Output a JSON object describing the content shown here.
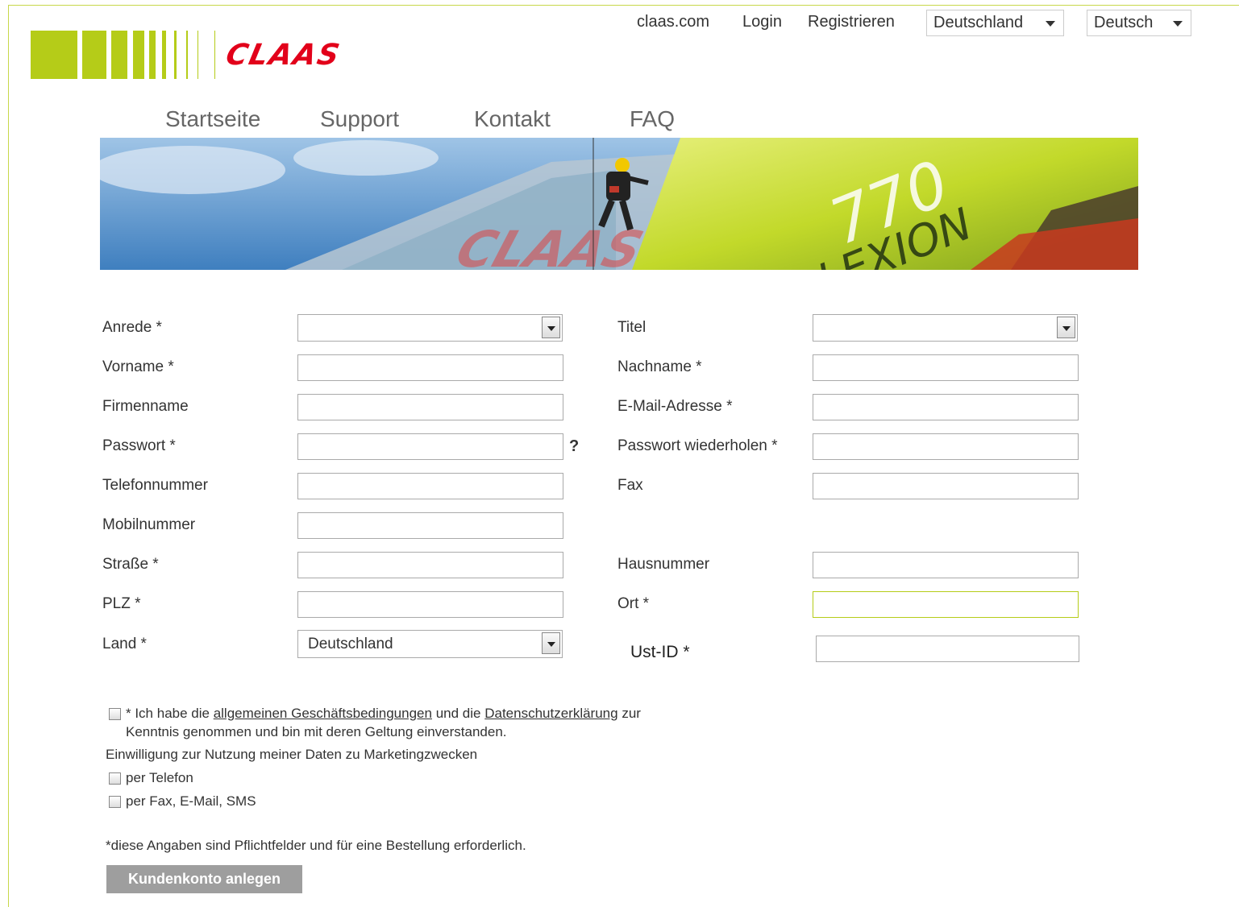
{
  "header": {
    "brand": "CLAAS",
    "links": {
      "claas": "claas.com",
      "login": "Login",
      "register": "Registrieren"
    },
    "country_select": "Deutschland",
    "language_select": "Deutsch"
  },
  "nav": {
    "home": "Startseite",
    "support": "Support",
    "contact": "Kontakt",
    "faq": "FAQ"
  },
  "banner": {
    "big_number": "770",
    "model": "LEXION",
    "brand": "CLAAS"
  },
  "form": {
    "anrede": {
      "label": "Anrede *",
      "value": ""
    },
    "titel": {
      "label": "Titel",
      "value": ""
    },
    "vorname": {
      "label": "Vorname *",
      "value": ""
    },
    "nachname": {
      "label": "Nachname *",
      "value": ""
    },
    "firmenname": {
      "label": "Firmenname",
      "value": ""
    },
    "email": {
      "label": "E-Mail-Adresse *",
      "value": ""
    },
    "passwort": {
      "label": "Passwort *",
      "value": ""
    },
    "passwort_help": "?",
    "passwort2": {
      "label": "Passwort wiederholen *",
      "value": ""
    },
    "telefon": {
      "label": "Telefonnummer",
      "value": ""
    },
    "fax": {
      "label": "Fax",
      "value": ""
    },
    "mobil": {
      "label": "Mobilnummer",
      "value": ""
    },
    "strasse": {
      "label": "Straße *",
      "value": ""
    },
    "hausnummer": {
      "label": "Hausnummer",
      "value": ""
    },
    "plz": {
      "label": "PLZ *",
      "value": ""
    },
    "ort": {
      "label": "Ort *",
      "value": ""
    },
    "land": {
      "label": "Land *",
      "value": "Deutschland"
    },
    "ustid": {
      "label": "Ust-ID *",
      "value": ""
    }
  },
  "consent": {
    "terms_prefix": "* Ich habe die",
    "terms_link": "allgemeinen Geschäftsbedingungen",
    "terms_mid": "und die",
    "privacy_link": "Datenschutzerklärung",
    "terms_suffix": "zur",
    "terms_line2": "Kenntnis genommen und bin mit deren Geltung einverstanden.",
    "marketing_heading": "Einwilligung zur Nutzung meiner Daten zu Marketingzwecken",
    "opt_phone": "per Telefon",
    "opt_fax": "per Fax, E-Mail, SMS"
  },
  "required_note": "*diese Angaben sind Pflichtfelder und für eine Bestellung erforderlich.",
  "submit_label": "Kundenkonto anlegen",
  "colors": {
    "brand_green": "#b5cc18",
    "brand_red": "#e2001a",
    "button_gray": "#9e9e9e"
  }
}
